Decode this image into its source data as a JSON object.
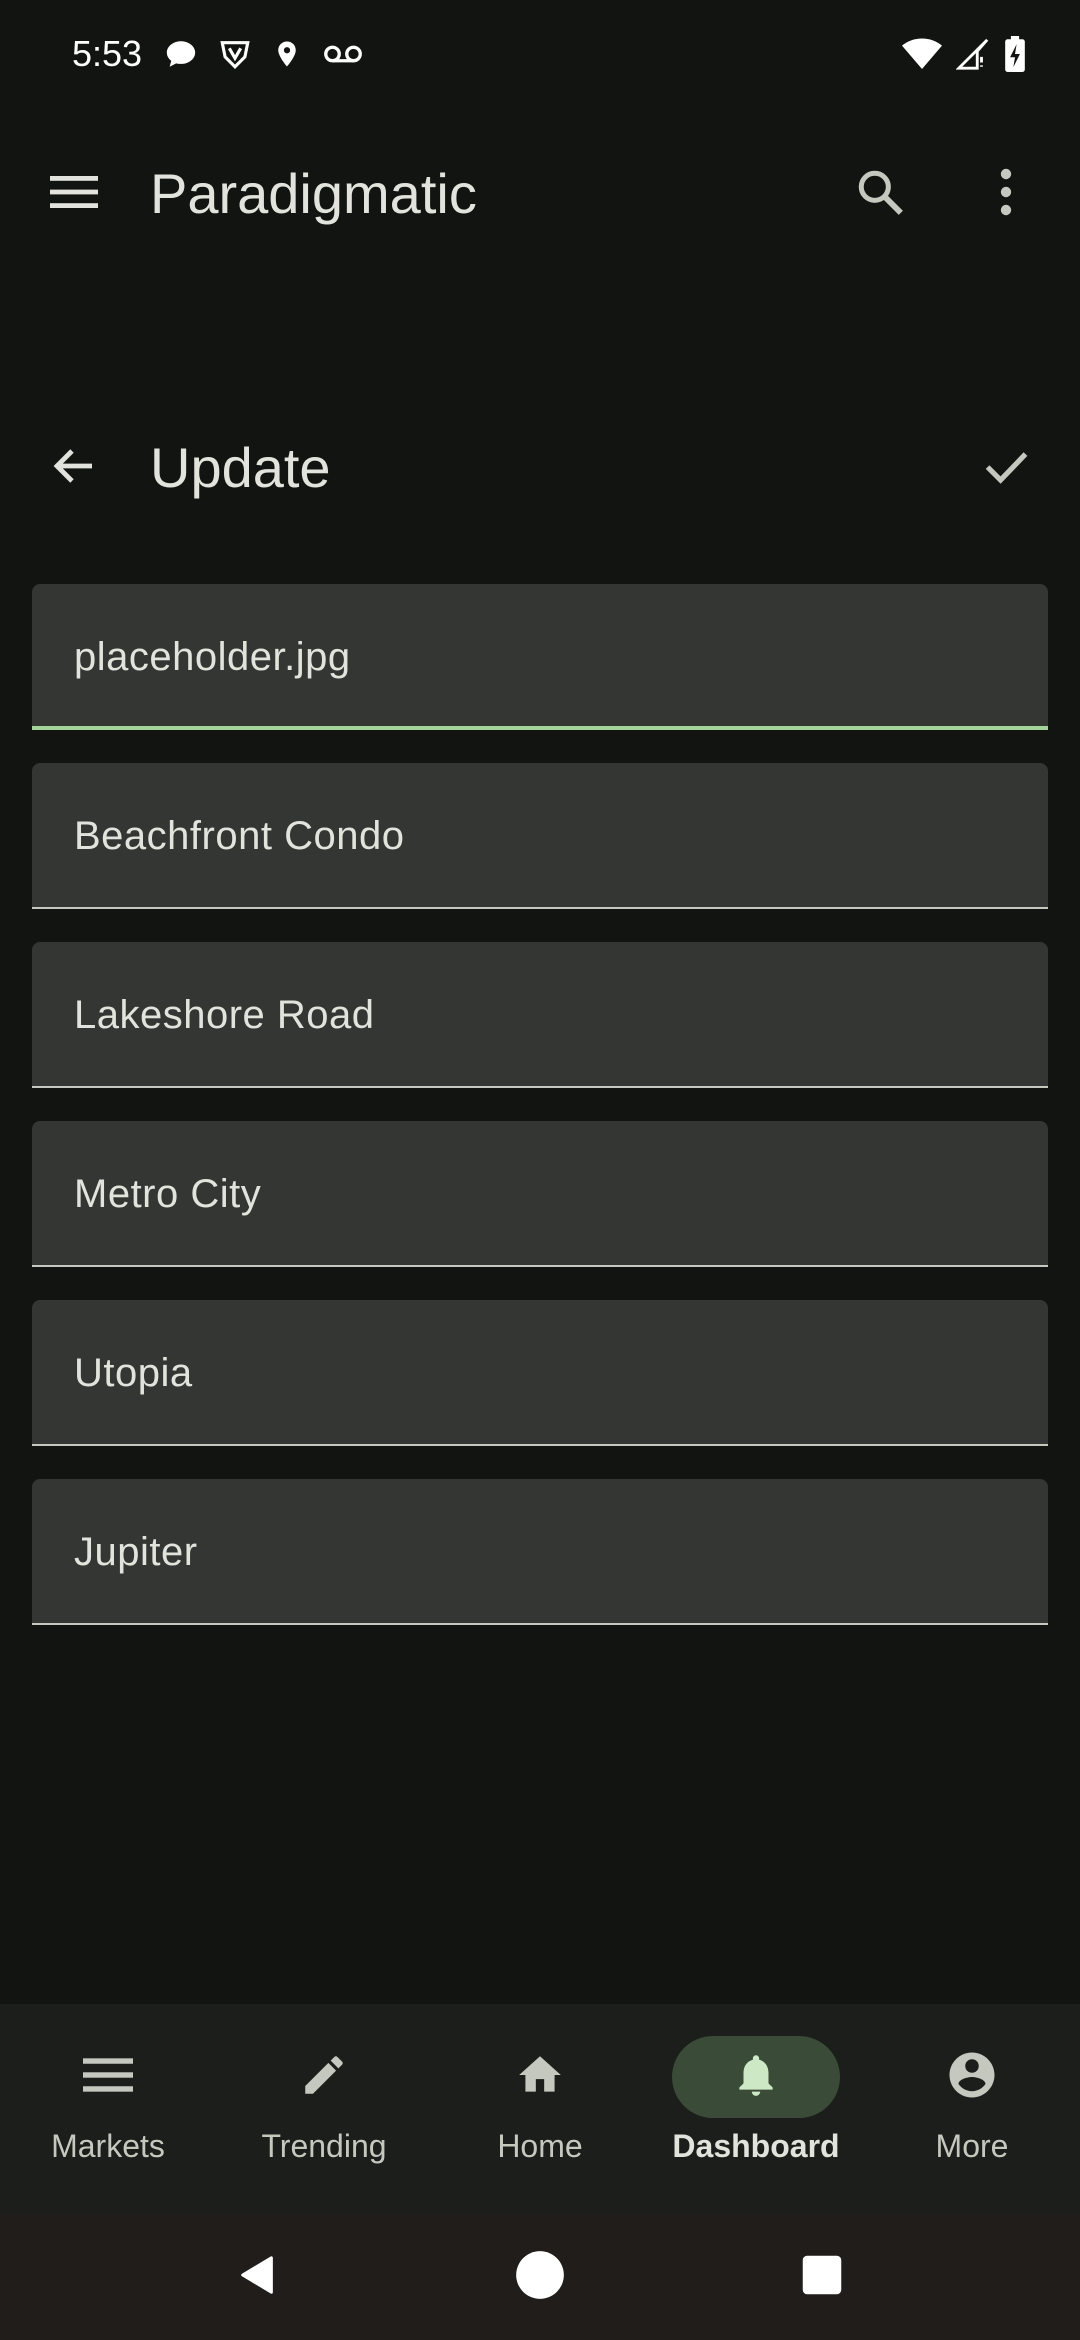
{
  "status_bar": {
    "time": "5:53",
    "icons": [
      "chat-bubble-icon",
      "shield-v-icon",
      "location-pin-icon",
      "voicemail-icon",
      "wifi-icon",
      "signal-icon",
      "battery-charging-icon"
    ]
  },
  "app_bar": {
    "title": "Paradigmatic",
    "icons": [
      "menu-icon",
      "search-icon",
      "more-vert-icon"
    ]
  },
  "sub_bar": {
    "title": "Update",
    "icons": [
      "back-arrow-icon",
      "check-icon"
    ]
  },
  "fields": [
    {
      "value": "placeholder.jpg",
      "focused": true
    },
    {
      "value": "Beachfront Condo",
      "focused": false
    },
    {
      "value": "Lakeshore Road",
      "focused": false
    },
    {
      "value": "Metro City",
      "focused": false
    },
    {
      "value": "Utopia",
      "focused": false
    },
    {
      "value": "Jupiter",
      "focused": false
    }
  ],
  "bottom_nav": {
    "items": [
      {
        "label": "Markets",
        "icon": "list-icon",
        "active": false
      },
      {
        "label": "Trending",
        "icon": "pencil-icon",
        "active": false
      },
      {
        "label": "Home",
        "icon": "home-icon",
        "active": false
      },
      {
        "label": "Dashboard",
        "icon": "bell-icon",
        "active": true
      },
      {
        "label": "More",
        "icon": "account-circle-icon",
        "active": false
      }
    ]
  },
  "system_nav": {
    "icons": [
      "back-triangle-icon",
      "home-circle-icon",
      "recents-square-icon"
    ]
  },
  "colors": {
    "background": "#121411",
    "field_background": "#333632",
    "focus_accent": "#a3d39a",
    "nav_background": "#1b1e1a",
    "active_pill": "#3a4b37"
  }
}
